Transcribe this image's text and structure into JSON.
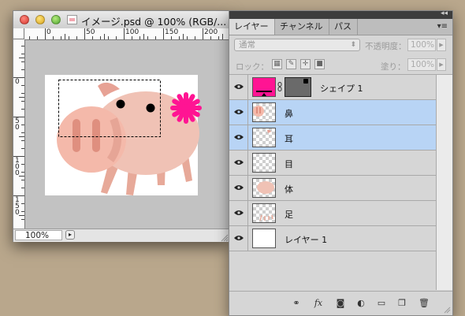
{
  "document": {
    "title": "イメージ.psd @ 100% (RGB/...",
    "ruler_top_labels": [
      "0",
      "50",
      "100",
      "150",
      "200"
    ],
    "ruler_left_labels": [
      "0",
      "50",
      "100",
      "150"
    ],
    "zoom": "100%"
  },
  "layers_panel": {
    "tabs": [
      {
        "label": "レイヤー"
      },
      {
        "label": "チャンネル"
      },
      {
        "label": "パス"
      }
    ],
    "blend_mode": "通常",
    "opacity_label": "不透明度：",
    "opacity_value": "100%",
    "lock_label": "ロック：",
    "fill_label": "塗り：",
    "fill_value": "100%",
    "layers": [
      {
        "name": "シェイプ 1",
        "selected": false
      },
      {
        "name": "鼻",
        "selected": true
      },
      {
        "name": "耳",
        "selected": true
      },
      {
        "name": "目",
        "selected": false
      },
      {
        "name": "体",
        "selected": false
      },
      {
        "name": "足",
        "selected": false
      },
      {
        "name": "レイヤー 1",
        "selected": false
      }
    ],
    "bottom_icons": [
      "link-layers-icon",
      "fx-icon",
      "add-mask-icon",
      "adjustment-layer-icon",
      "new-group-icon",
      "new-layer-icon",
      "trash-icon"
    ]
  },
  "colors": {
    "shape_fill": "#ff1493",
    "selected_row": "#b8d4f5",
    "pig_body": "#f0c2b5",
    "pig_snout": "#f4b9aa"
  }
}
